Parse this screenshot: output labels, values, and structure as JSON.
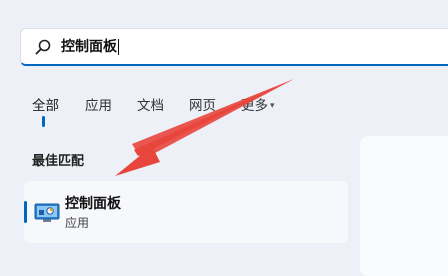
{
  "search": {
    "value": "控制面板"
  },
  "tabs": [
    {
      "label": "全部"
    },
    {
      "label": "应用"
    },
    {
      "label": "文档"
    },
    {
      "label": "网页"
    },
    {
      "label": "更多"
    }
  ],
  "best_match": {
    "section_title": "最佳匹配",
    "result": {
      "title": "控制面板",
      "subtitle": "应用",
      "icon": "control-panel-icon"
    }
  },
  "colors": {
    "accent": "#0067c0",
    "annotation_arrow": "#e8453c"
  }
}
